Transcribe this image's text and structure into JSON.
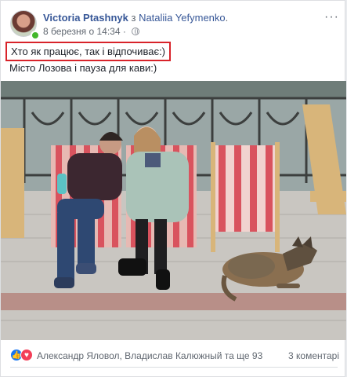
{
  "post": {
    "author": "Victoria Ptashnyk",
    "with_word": " з ",
    "tagged": "Nataliia Yefymenko",
    "tagged_suffix": ".",
    "timestamp": "8 березня о 14:34 ·",
    "more_icon": "ellipsis-icon",
    "line1": "Хто як працює, так і відпочиває:)",
    "line2": "Місто Лозова і пауза для кави:)"
  },
  "footer": {
    "reactions": [
      "like",
      "love"
    ],
    "reactors_text": "Александр Яловол, Владислав Калюжный та ще 93",
    "comments_text": "3 коментарі"
  },
  "colors": {
    "link": "#385898",
    "highlight_border": "#d8232a",
    "like": "#1877f2",
    "love": "#f33e58"
  }
}
